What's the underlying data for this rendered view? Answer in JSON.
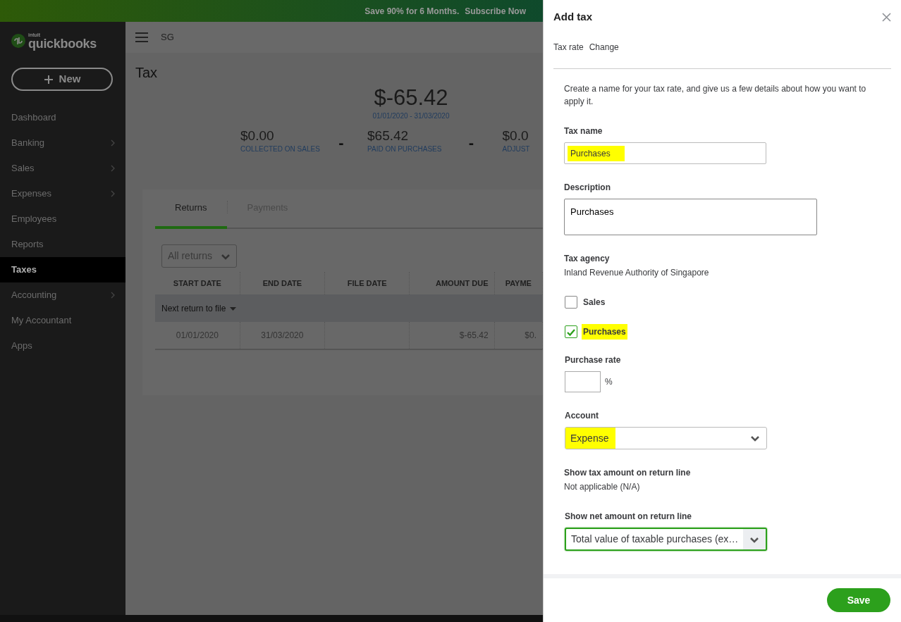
{
  "banner": {
    "text": "Save 90% for 6 Months.",
    "link": "Subscribe Now"
  },
  "sidebar": {
    "logo_small": "intuit",
    "logo": "quickbooks",
    "new_button": "New",
    "items": [
      {
        "label": "Dashboard",
        "selected": false,
        "has_submenu": false
      },
      {
        "label": "Banking",
        "selected": false,
        "has_submenu": true
      },
      {
        "label": "Sales",
        "selected": false,
        "has_submenu": true
      },
      {
        "label": "Expenses",
        "selected": false,
        "has_submenu": true
      },
      {
        "label": "Employees",
        "selected": false,
        "has_submenu": false
      },
      {
        "label": "Reports",
        "selected": false,
        "has_submenu": false
      },
      {
        "label": "Taxes",
        "selected": true,
        "has_submenu": false
      },
      {
        "label": "Accounting",
        "selected": false,
        "has_submenu": true
      },
      {
        "label": "My Accountant",
        "selected": false,
        "has_submenu": false
      },
      {
        "label": "Apps",
        "selected": false,
        "has_submenu": false
      }
    ]
  },
  "header": {
    "company": "SG"
  },
  "page_title": "Tax",
  "summary": {
    "amount": "$-65.42",
    "period": "01/01/2020 - 31/03/2020",
    "operators": [
      "-",
      "-"
    ],
    "stats": [
      {
        "value": "$0.00",
        "label": "COLLECTED ON SALES"
      },
      {
        "value": "$65.42",
        "label": "PAID ON PURCHASES"
      },
      {
        "value": "$0.0",
        "label": "ADJUST"
      }
    ]
  },
  "tabs": [
    {
      "label": "Returns",
      "selected": true
    },
    {
      "label": "Payments",
      "selected": false
    }
  ],
  "filter": {
    "value": "All returns"
  },
  "table": {
    "columns": [
      "START DATE",
      "END DATE",
      "FILE DATE",
      "AMOUNT DUE",
      "PAYME"
    ],
    "group": "Next return to file",
    "rows": [
      [
        "01/01/2020",
        "31/03/2020",
        null,
        "$-65.42",
        "$0."
      ]
    ]
  },
  "panel": {
    "title": "Add tax",
    "tax_rate_label": "Tax rate",
    "change_link": "Change",
    "intro": "Create a name for your tax rate, and give us a few details about how you want to apply it.",
    "fields": [
      {
        "kind": "text",
        "label": "Tax name",
        "value": "Purchases",
        "highlighted": true
      },
      {
        "kind": "textarea",
        "label": "Description",
        "value": "Purchases"
      },
      {
        "kind": "static",
        "label": "Tax agency",
        "value": "Inland Revenue Authority of Singapore"
      },
      {
        "kind": "checkbox",
        "label": "Sales",
        "checked": false,
        "highlighted": false
      },
      {
        "kind": "checkbox",
        "label": "Purchases",
        "checked": true,
        "highlighted": true
      },
      {
        "kind": "percent",
        "label": "Purchase rate",
        "unit": "%"
      },
      {
        "kind": "select",
        "label": "Account",
        "value": "Expense",
        "highlighted": true,
        "focused": false
      },
      {
        "kind": "static",
        "label": "Show tax amount on return line",
        "value": "Not applicable (N/A)"
      },
      {
        "kind": "select",
        "label": "Show net amount on return line",
        "value": "Total value of taxable purchases (ex…",
        "highlighted": false,
        "focused": true
      }
    ],
    "save": "Save"
  }
}
